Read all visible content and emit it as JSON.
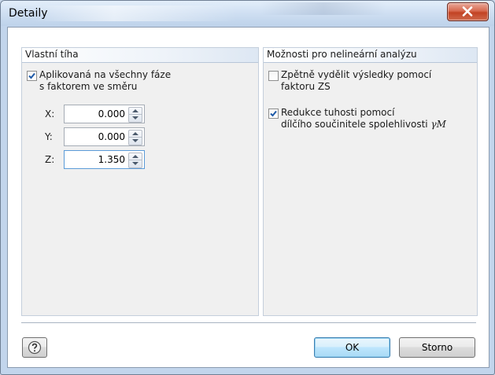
{
  "window": {
    "title": "Detaily",
    "close_icon": "close-x-icon"
  },
  "self_weight": {
    "title": "Vlastní tíha",
    "apply_checked": true,
    "apply_label_line1": "Aplikovaná na všechny fáze",
    "apply_label_line2": "s faktorem ve směru",
    "fields": [
      {
        "axis": "X:",
        "value": "0.000"
      },
      {
        "axis": "Y:",
        "value": "0.000"
      },
      {
        "axis": "Z:",
        "value": "1.350"
      }
    ]
  },
  "nonlinear": {
    "title": "Možnosti pro nelineární analýzu",
    "option1_checked": false,
    "option1_line1": "Zpětně vydělit výsledky pomocí",
    "option1_line2": "faktoru ZS",
    "option2_checked": true,
    "option2_line1": "Redukce tuhosti pomocí",
    "option2_line2": "dílčího součinitele spolehlivosti",
    "option2_symbol": "γM"
  },
  "buttons": {
    "help_icon": "help-question-icon",
    "ok_label": "OK",
    "cancel_label": "Storno"
  },
  "colors": {
    "close_button": "#c24323",
    "checkbox_check": "#1e5aa8",
    "default_button": "#bee6fd"
  }
}
